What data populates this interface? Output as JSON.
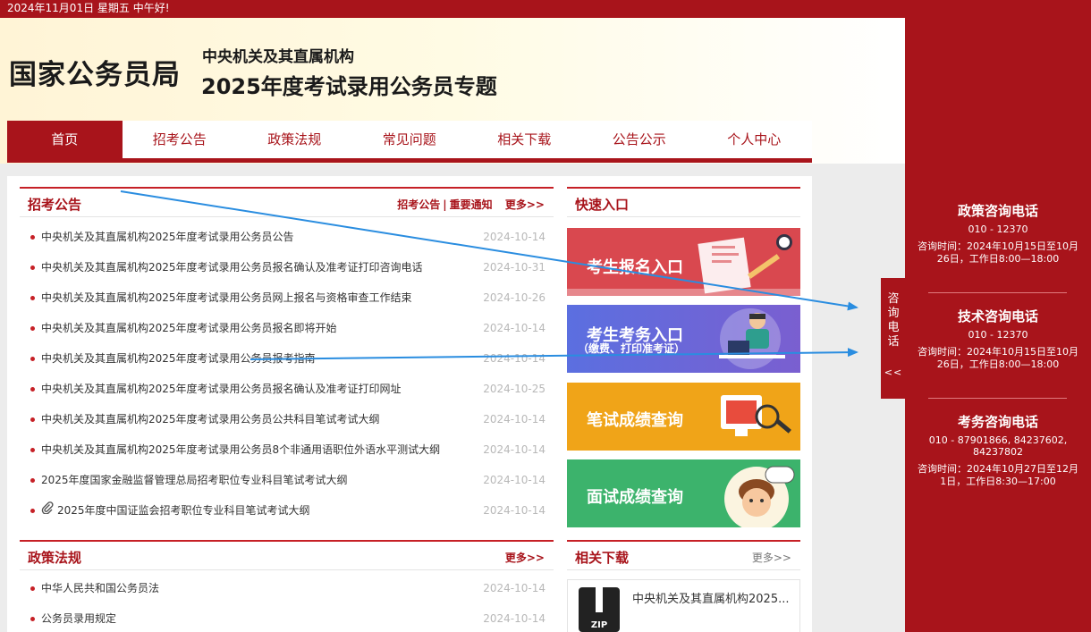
{
  "topbar": {
    "date_text": "2024年11月01日  星期五  中午好!"
  },
  "header": {
    "logo_text": "国家公务员局",
    "subtitle": "中央机关及其直属机构",
    "title": "2025年度考试录用公务员专题"
  },
  "nav": {
    "items": [
      {
        "label": "首页",
        "active": true
      },
      {
        "label": "招考公告"
      },
      {
        "label": "政策法规"
      },
      {
        "label": "常见问题"
      },
      {
        "label": "相关下载"
      },
      {
        "label": "公告公示"
      },
      {
        "label": "个人中心"
      }
    ]
  },
  "announcements": {
    "title": "招考公告",
    "tab_a": "招考公告",
    "separator": "|",
    "tab_b": "重要通知",
    "more": "更多>>",
    "items": [
      {
        "text": "中央机关及其直属机构2025年度考试录用公务员公告",
        "date": "2024-10-14"
      },
      {
        "text": "中央机关及其直属机构2025年度考试录用公务员报名确认及准考证打印咨询电话",
        "date": "2024-10-31"
      },
      {
        "text": "中央机关及其直属机构2025年度考试录用公务员网上报名与资格审查工作结束",
        "date": "2024-10-26"
      },
      {
        "text": "中央机关及其直属机构2025年度考试录用公务员报名即将开始",
        "date": "2024-10-14"
      },
      {
        "text": "中央机关及其直属机构2025年度考试录用公务员报考指南",
        "date": "2024-10-14"
      },
      {
        "text": "中央机关及其直属机构2025年度考试录用公务员报名确认及准考证打印网址",
        "date": "2024-10-25"
      },
      {
        "text": "中央机关及其直属机构2025年度考试录用公务员公共科目笔试考试大纲",
        "date": "2024-10-14"
      },
      {
        "text": "中央机关及其直属机构2025年度考试录用公务员8个非通用语职位外语水平测试大纲",
        "date": "2024-10-14"
      },
      {
        "text": "2025年度国家金融监督管理总局招考职位专业科目笔试考试大纲",
        "date": "2024-10-14"
      },
      {
        "text": "2025年度中国证监会招考职位专业科目笔试考试大纲",
        "date": "2024-10-14",
        "attachment": true
      }
    ]
  },
  "quick_entry": {
    "title": "快速入口",
    "banners": [
      {
        "label": "考生报名入口",
        "color": "#d9484f"
      },
      {
        "label": "考生考务入口",
        "sublabel": "（缴费、打印准考证）",
        "color": "#6a6fd8"
      },
      {
        "label": "笔试成绩查询",
        "color": "#f0a418"
      },
      {
        "label": "面试成绩查询",
        "color": "#3cb36c"
      }
    ]
  },
  "policy": {
    "title": "政策法规",
    "more": "更多>>",
    "items": [
      {
        "text": "中华人民共和国公务员法",
        "date": "2024-10-14"
      },
      {
        "text": "公务员录用规定",
        "date": "2024-10-14"
      }
    ]
  },
  "downloads": {
    "title": "相关下载",
    "more": "更多>>",
    "item_text": "中央机关及其直属机构2025...",
    "file_type": "ZIP"
  },
  "side_tab": {
    "label_chars": [
      "咨",
      "询",
      "电",
      "话"
    ],
    "toggle": "<<"
  },
  "contacts": [
    {
      "title": "政策咨询电话",
      "phone": "010 - 12370",
      "time": "咨询时间：2024年10月15日至10月26日，工作日8:00—18:00"
    },
    {
      "title": "技术咨询电话",
      "phone": "010 - 12370",
      "time": "咨询时间：2024年10月15日至10月26日，工作日8:00—18:00"
    },
    {
      "title": "考务咨询电话",
      "phone": "010 - 87901866, 84237602, 84237802",
      "time": "咨询时间：2024年10月27日至12月1日，工作日8:30—17:00"
    }
  ],
  "colors": {
    "brand_red": "#a8141b",
    "accent_red": "#c62026",
    "arrow_blue": "#2a8de0"
  }
}
